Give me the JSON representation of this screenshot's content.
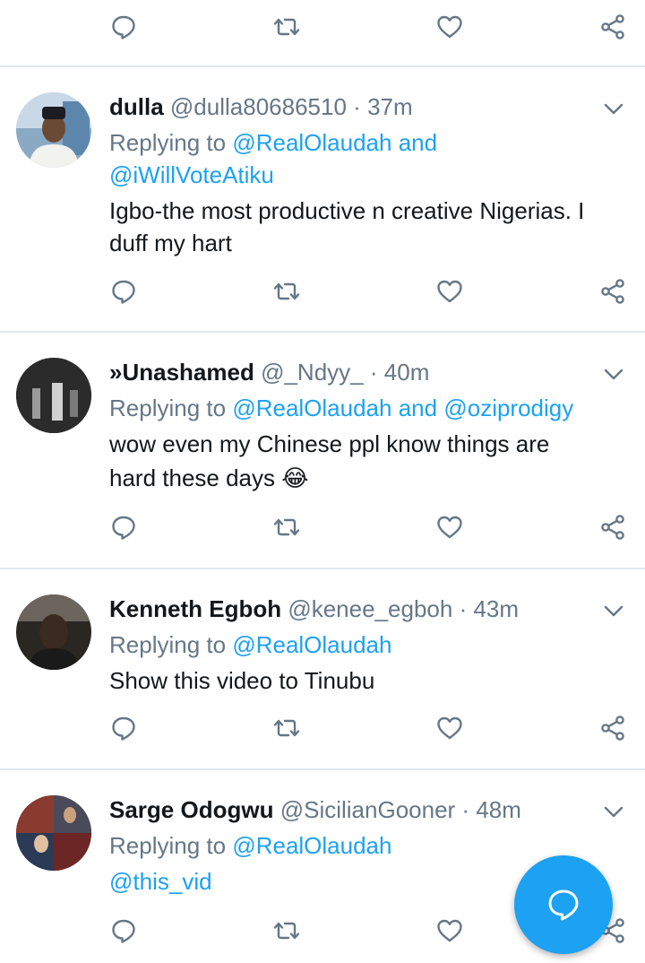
{
  "colors": {
    "accent": "#1da1f2",
    "muted": "#657786",
    "divider": "#e1e8ed"
  },
  "icons": [
    "reply-icon",
    "retweet-icon",
    "like-icon",
    "share-icon",
    "chevron-down-icon",
    "compose-tweet-icon"
  ],
  "tweets": [
    {
      "name": "dulla",
      "handle": "@dulla80686510",
      "sep": "·",
      "time": "37m",
      "replying_label": "Replying to",
      "reply_line1_link": "@RealOlaudah and",
      "reply_line2_link": "@iWillVoteAtiku",
      "text_line1": "Igbo-the most productive n creative Nigerias. I",
      "text_line2": "duff my hart"
    },
    {
      "name": "»Unashamed",
      "handle": "@_Ndyy_",
      "sep": "·",
      "time": "40m",
      "replying_label": "Replying to",
      "reply_link1": "@RealOlaudah",
      "reply_and": "and",
      "reply_link2": "@oziprodigy",
      "text_line1": "wow even my Chinese ppl know things are",
      "text_line2": "hard these days",
      "emoji": "😂"
    },
    {
      "name": "Kenneth Egboh",
      "handle": "@kenee_egboh",
      "sep": "·",
      "time": "43m",
      "replying_label": "Replying to",
      "reply_link1": "@RealOlaudah",
      "text_line1": "Show this video to Tinubu"
    },
    {
      "name": "Sarge Odogwu",
      "handle": "@SicilianGooner",
      "sep": "·",
      "time": "48m",
      "replying_label": "Replying to",
      "reply_link1": "@RealOlaudah",
      "reply_line2_link": "@this_vid"
    }
  ]
}
